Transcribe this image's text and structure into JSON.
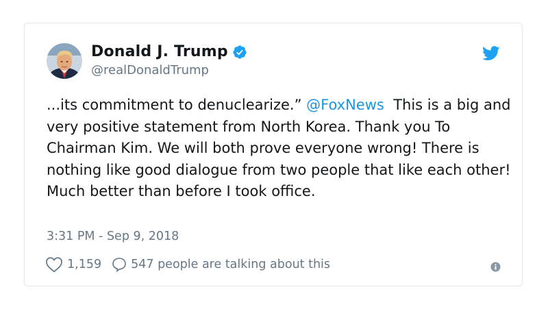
{
  "tweet": {
    "author_name": "Donald J. Trump",
    "handle": "@realDonaldTrump",
    "text_before": "...its commitment to denuclearize.” ",
    "mention": "@FoxNews",
    "text_after": "  This is a big and very positive statement from North Korea. Thank you To Chairman Kim. We will both prove everyone wrong! There is nothing like good dialogue from two people that like each other! Much better than before I took office.",
    "timestamp": "3:31 PM - Sep 9, 2018",
    "like_count": "1,159",
    "talking_text": "547 people are talking about this"
  },
  "icons": {
    "avatar": "profile-photo",
    "verified": "verified-badge-icon",
    "logo": "twitter-bird-icon",
    "like": "heart-icon",
    "reply": "speech-bubble-icon",
    "info": "info-icon"
  },
  "colors": {
    "accent": "#1da1f2",
    "link": "#1b95e0",
    "secondary_text": "#657786",
    "border": "#e1e8ed"
  }
}
